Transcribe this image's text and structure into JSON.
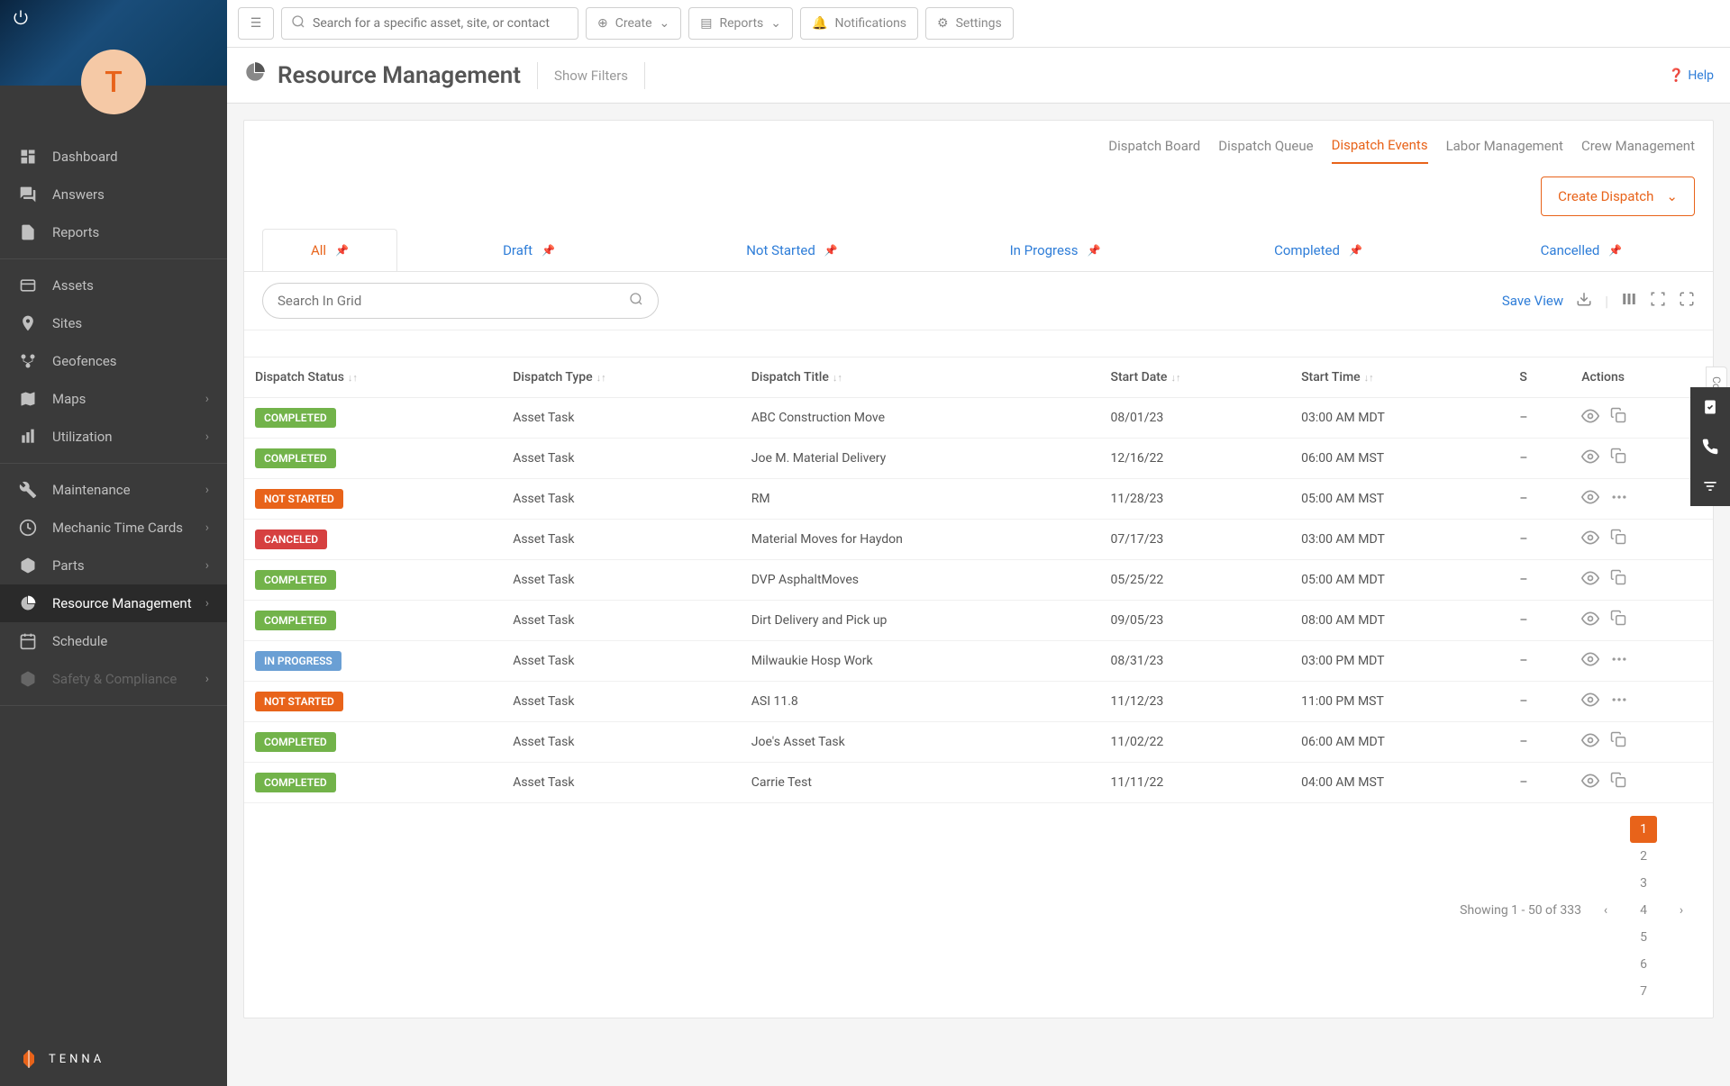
{
  "avatar_initial": "T",
  "sidebar": {
    "groups": [
      [
        {
          "icon": "dashboard",
          "label": "Dashboard"
        },
        {
          "icon": "answers",
          "label": "Answers"
        },
        {
          "icon": "reports",
          "label": "Reports"
        }
      ],
      [
        {
          "icon": "assets",
          "label": "Assets"
        },
        {
          "icon": "sites",
          "label": "Sites"
        },
        {
          "icon": "geofences",
          "label": "Geofences"
        },
        {
          "icon": "maps",
          "label": "Maps",
          "chevron": true
        },
        {
          "icon": "utilization",
          "label": "Utilization",
          "chevron": true
        }
      ],
      [
        {
          "icon": "maintenance",
          "label": "Maintenance",
          "chevron": true
        },
        {
          "icon": "time",
          "label": "Mechanic Time Cards",
          "chevron": true
        },
        {
          "icon": "parts",
          "label": "Parts",
          "chevron": true
        },
        {
          "icon": "resource",
          "label": "Resource Management",
          "chevron": true,
          "active": true
        },
        {
          "icon": "schedule",
          "label": "Schedule"
        },
        {
          "icon": "safety",
          "label": "Safety & Compliance",
          "chevron": true,
          "faded": true
        }
      ]
    ],
    "brand": "TENNA"
  },
  "topbar": {
    "search_placeholder": "Search for a specific asset, site, or contact",
    "create_label": "Create",
    "reports_label": "Reports",
    "notifications_label": "Notifications",
    "settings_label": "Settings"
  },
  "page": {
    "title": "Resource Management",
    "show_filters": "Show Filters",
    "help": "Help"
  },
  "subtabs": [
    "Dispatch Board",
    "Dispatch Queue",
    "Dispatch Events",
    "Labor Management",
    "Crew Management"
  ],
  "subtab_active": "Dispatch Events",
  "create_dispatch": "Create Dispatch",
  "status_tabs": [
    "All",
    "Draft",
    "Not Started",
    "In Progress",
    "Completed",
    "Cancelled"
  ],
  "status_tab_active": "All",
  "grid_search_placeholder": "Search In Grid",
  "save_view": "Save View",
  "columns_label": "Columns",
  "table": {
    "headers": [
      "Dispatch Status",
      "Dispatch Type",
      "Dispatch Title",
      "Start Date",
      "Start Time",
      "S",
      "Actions"
    ],
    "rows": [
      {
        "status": "COMPLETED",
        "status_class": "completed",
        "type": "Asset Task",
        "title": "ABC Construction Move",
        "date": "08/01/23",
        "time": "03:00 AM MDT",
        "s": "–",
        "action2": "copy"
      },
      {
        "status": "COMPLETED",
        "status_class": "completed",
        "type": "Asset Task",
        "title": "Joe M. Material Delivery",
        "date": "12/16/22",
        "time": "06:00 AM MST",
        "s": "–",
        "action2": "copy"
      },
      {
        "status": "NOT STARTED",
        "status_class": "notstarted",
        "type": "Asset Task",
        "title": "RM",
        "date": "11/28/23",
        "time": "05:00 AM MST",
        "s": "–",
        "action2": "dots"
      },
      {
        "status": "CANCELED",
        "status_class": "canceled",
        "type": "Asset Task",
        "title": "Material Moves for Haydon",
        "date": "07/17/23",
        "time": "03:00 AM MDT",
        "s": "–",
        "action2": "copy"
      },
      {
        "status": "COMPLETED",
        "status_class": "completed",
        "type": "Asset Task",
        "title": "DVP AsphaltMoves",
        "date": "05/25/22",
        "time": "05:00 AM MDT",
        "s": "–",
        "action2": "copy"
      },
      {
        "status": "COMPLETED",
        "status_class": "completed",
        "type": "Asset Task",
        "title": "Dirt Delivery and Pick up",
        "date": "09/05/23",
        "time": "08:00 AM MDT",
        "s": "–",
        "action2": "copy"
      },
      {
        "status": "IN PROGRESS",
        "status_class": "inprogress",
        "type": "Asset Task",
        "title": "Milwaukie Hosp Work",
        "date": "08/31/23",
        "time": "03:00 PM MDT",
        "s": "–",
        "action2": "dots"
      },
      {
        "status": "NOT STARTED",
        "status_class": "notstarted",
        "type": "Asset Task",
        "title": "ASI 11.8",
        "date": "11/12/23",
        "time": "11:00 PM MST",
        "s": "–",
        "action2": "dots"
      },
      {
        "status": "COMPLETED",
        "status_class": "completed",
        "type": "Asset Task",
        "title": "Joe's Asset Task",
        "date": "11/02/22",
        "time": "06:00 AM MDT",
        "s": "–",
        "action2": "copy"
      },
      {
        "status": "COMPLETED",
        "status_class": "completed",
        "type": "Asset Task",
        "title": "Carrie Test",
        "date": "11/11/22",
        "time": "04:00 AM MST",
        "s": "–",
        "action2": "copy"
      }
    ]
  },
  "pagination": {
    "summary": "Showing 1 - 50 of 333",
    "pages": [
      "1",
      "2",
      "3",
      "4",
      "5",
      "6",
      "7"
    ],
    "active": "1"
  }
}
